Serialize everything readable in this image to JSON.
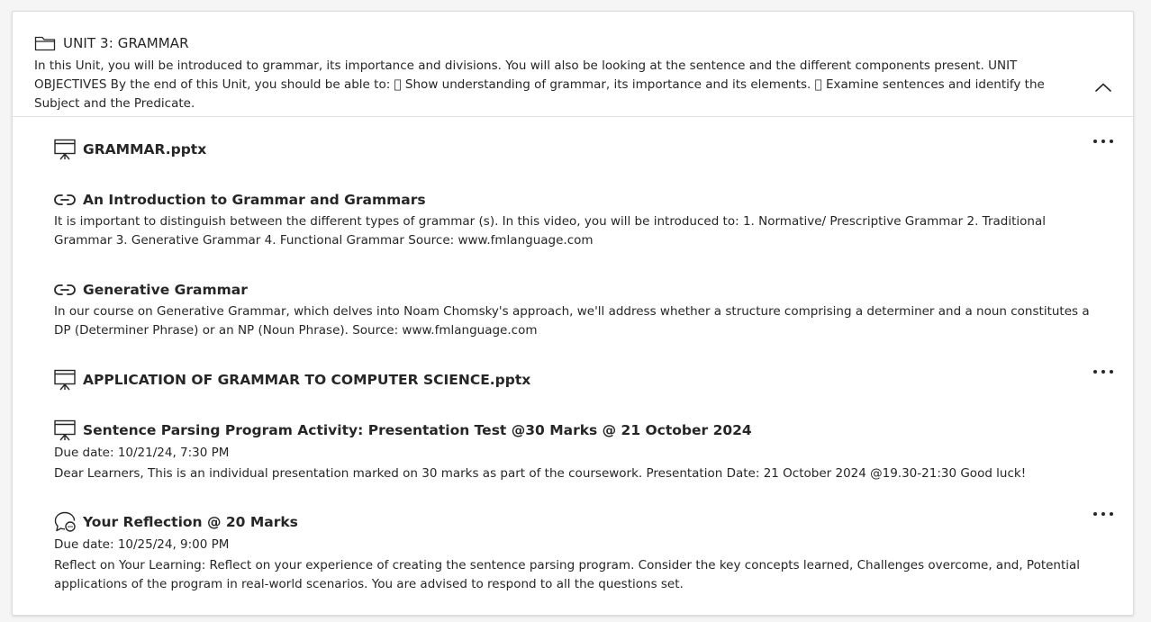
{
  "unit": {
    "title": "UNIT 3: GRAMMAR",
    "description": "In this Unit, you will be introduced to grammar, its importance and divisions. You will also be looking at the sentence and the different components present. UNIT OBJECTIVES By the end of this Unit, you should be able to:  Show understanding of grammar, its importance and its elements.  Examine sentences and identify the Subject and the Predicate."
  },
  "items": [
    {
      "icon": "presentation-icon",
      "title": "GRAMMAR.pptx"
    },
    {
      "icon": "link-icon",
      "title": "An Introduction to Grammar and Grammars",
      "description": "It is important to distinguish between the different types of grammar (s). In this video, you will be introduced to: 1. Normative/ Prescriptive Grammar 2. Traditional Grammar 3. Generative Grammar 4. Functional Grammar Source: www.fmlanguage.com"
    },
    {
      "icon": "link-icon",
      "title": "Generative Grammar",
      "description": "In our course on Generative Grammar, which delves into Noam Chomsky's approach, we'll address whether a structure comprising a determiner and a noun constitutes a DP (Determiner Phrase) or an NP (Noun Phrase). Source: www.fmlanguage.com"
    },
    {
      "icon": "presentation-icon",
      "title": "APPLICATION OF GRAMMAR TO COMPUTER SCIENCE.pptx"
    },
    {
      "icon": "presentation-icon",
      "title": "Sentence Parsing Program Activity: Presentation Test @30 Marks @ 21 October 2024",
      "due": "Due date: 10/21/24, 7:30 PM",
      "description": "Dear Learners, This is an individual presentation marked on 30 marks as part of the coursework. Presentation Date: 21 October 2024 @19.30-21:30 Good luck!"
    },
    {
      "icon": "discussion-icon",
      "title": "Your Reflection @ 20 Marks",
      "due": "Due date: 10/25/24, 9:00 PM",
      "description": "Reflect on Your Learning: Reflect on your experience of creating the sentence parsing program. Consider the key concepts learned, Challenges overcome, and, Potential applications of the program in real-world scenarios. You are advised to respond to all the questions set."
    }
  ]
}
